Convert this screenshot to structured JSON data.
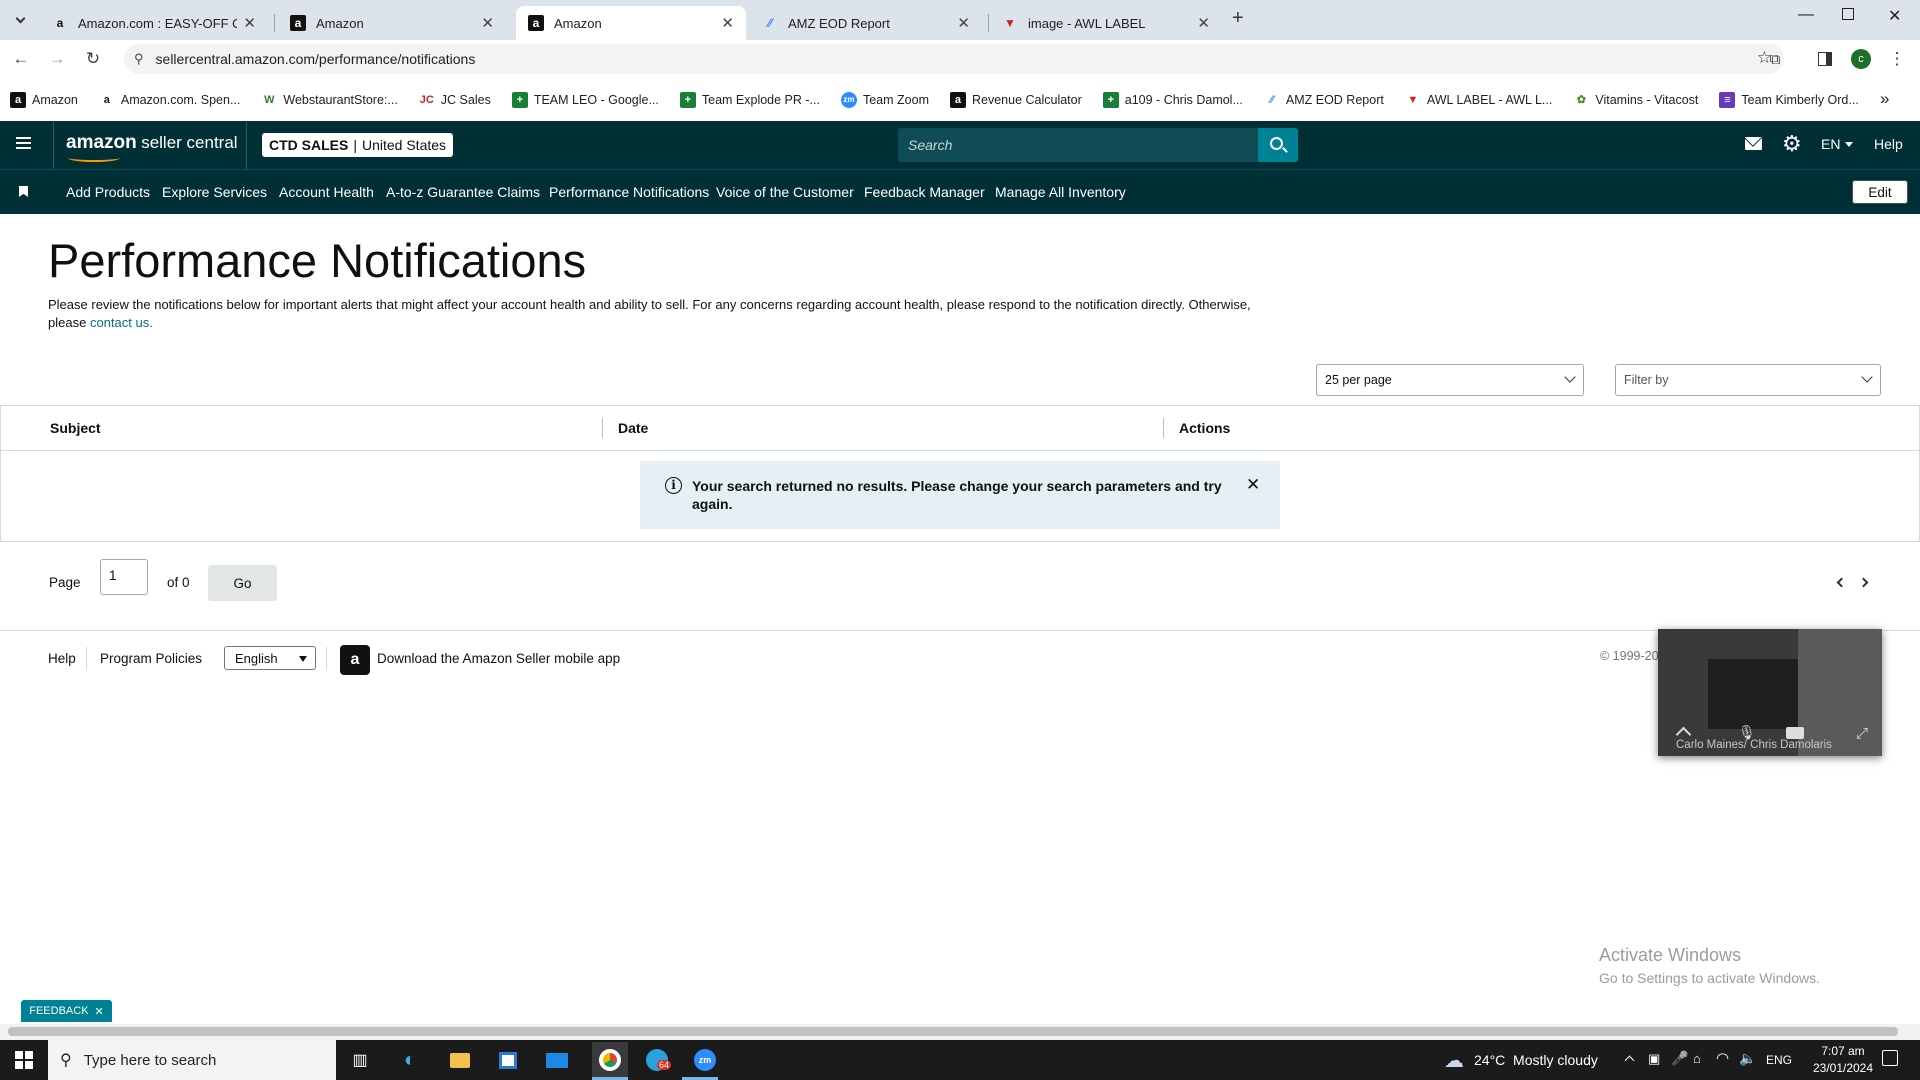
{
  "browser": {
    "tabs": [
      {
        "title": "Amazon.com : EASY-OFF OVEN",
        "favicon": "amazon-icon"
      },
      {
        "title": "Amazon",
        "favicon": "amazon-icon"
      },
      {
        "title": "Amazon",
        "favicon": "amazon-icon",
        "active": true
      },
      {
        "title": "AMZ EOD Report",
        "favicon": "report-icon"
      },
      {
        "title": "image - AWL LABEL",
        "favicon": "awl-icon"
      }
    ],
    "url": "sellercentral.amazon.com/performance/notifications",
    "profile_initial": "c",
    "bookmarks": [
      {
        "label": "Amazon"
      },
      {
        "label": "Amazon.com. Spen..."
      },
      {
        "label": "WebstaurantStore:..."
      },
      {
        "label": "JC Sales"
      },
      {
        "label": "TEAM LEO - Google..."
      },
      {
        "label": "Team Explode PR -..."
      },
      {
        "label": "Team Zoom"
      },
      {
        "label": "Revenue Calculator"
      },
      {
        "label": "a109 - Chris Damol..."
      },
      {
        "label": "AMZ EOD Report"
      },
      {
        "label": "AWL LABEL - AWL L..."
      },
      {
        "label": "Vitamins - Vitacost"
      },
      {
        "label": "Team Kimberly Ord..."
      }
    ],
    "more_bookmarks": "»"
  },
  "header": {
    "logo_amazon": "amazon",
    "logo_suffix": "seller central",
    "store_name": "CTD SALES",
    "store_region": "United States",
    "search_placeholder": "Search",
    "language": "EN",
    "help": "Help"
  },
  "nav": {
    "links": [
      "Add Products",
      "Explore Services",
      "Account Health",
      "A-to-z Guarantee Claims",
      "Performance Notifications",
      "Voice of the Customer",
      "Feedback Manager",
      "Manage All Inventory"
    ],
    "edit": "Edit"
  },
  "page": {
    "title": "Performance Notifications",
    "intro_text": "Please review the notifications below for important alerts that might affect your account health and ability to sell. For any concerns regarding account health, please respond to the notification directly. Otherwise, please",
    "intro_link": "contact us.",
    "per_page": "25 per page",
    "filter": "Filter by",
    "columns": [
      "Subject",
      "Date",
      "Actions"
    ],
    "alert": "Your search returned no results. Please change your search parameters and try again.",
    "pager": {
      "label": "Page",
      "value": "1",
      "of": "of 0",
      "go": "Go"
    }
  },
  "footer": {
    "help": "Help",
    "policies": "Program Policies",
    "language": "English",
    "app": "Download the Amazon Seller mobile app",
    "copyright": "© 1999-20"
  },
  "overlay": {
    "video_names": "Carlo Maines/ Chris Damolaris",
    "activate_title": "Activate Windows",
    "activate_sub": "Go to Settings to activate Windows.",
    "feedback": "FEEDBACK"
  },
  "taskbar": {
    "search": "Type here to search",
    "weather": "24°C  Mostly cloudy",
    "lang": "ENG",
    "time": "7:07 am",
    "date": "23/01/2024",
    "telegram_badge": "64"
  },
  "colors": {
    "header_bg": "#002f36",
    "search_btn": "#008296",
    "link": "#007185",
    "alert_bg": "#e4f0f3"
  }
}
